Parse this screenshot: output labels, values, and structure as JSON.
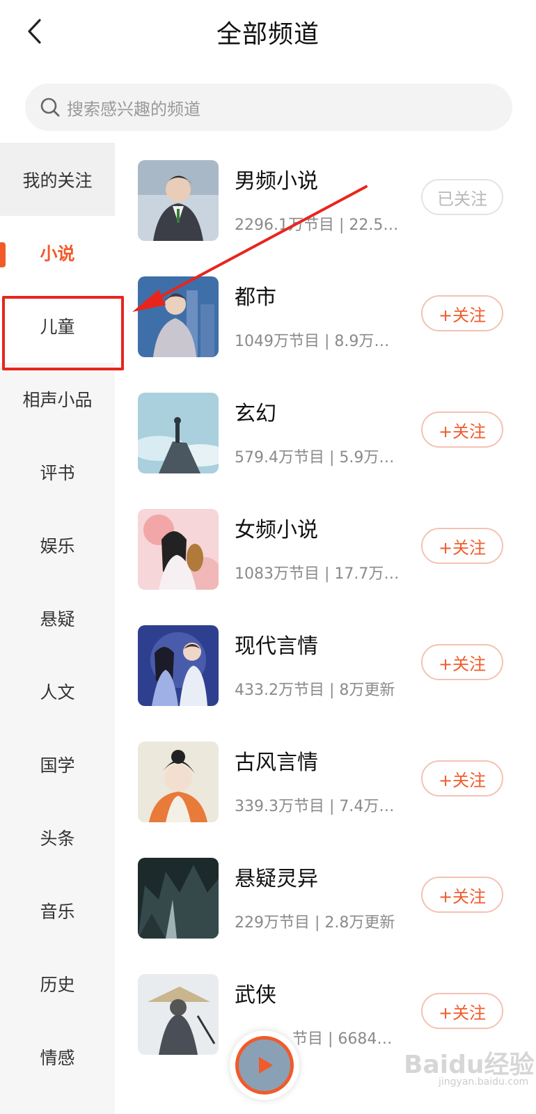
{
  "header": {
    "title": "全部频道",
    "back_icon": "chevron-left-icon"
  },
  "search": {
    "placeholder": "搜索感兴趣的频道",
    "icon": "search-icon"
  },
  "sidebar": {
    "items": [
      {
        "label": "我的关注"
      },
      {
        "label": "小说"
      },
      {
        "label": "儿童"
      },
      {
        "label": "相声小品"
      },
      {
        "label": "评书"
      },
      {
        "label": "娱乐"
      },
      {
        "label": "悬疑"
      },
      {
        "label": "人文"
      },
      {
        "label": "国学"
      },
      {
        "label": "头条"
      },
      {
        "label": "音乐"
      },
      {
        "label": "历史"
      },
      {
        "label": "情感"
      }
    ],
    "active_index": 1
  },
  "channels": [
    {
      "name": "男频小说",
      "meta": "2296.1万节目 | 22.5…",
      "button": "已关注",
      "followed": true
    },
    {
      "name": "都市",
      "meta": "1049万节目 | 8.9万…",
      "button": "+关注",
      "followed": false
    },
    {
      "name": "玄幻",
      "meta": "579.4万节目 | 5.9万…",
      "button": "+关注",
      "followed": false
    },
    {
      "name": "女频小说",
      "meta": "1083万节目 | 17.7万…",
      "button": "+关注",
      "followed": false
    },
    {
      "name": "现代言情",
      "meta": "433.2万节目 | 8万更新",
      "button": "+关注",
      "followed": false
    },
    {
      "name": "古风言情",
      "meta": "339.3万节目 | 7.4万…",
      "button": "+关注",
      "followed": false
    },
    {
      "name": "悬疑灵异",
      "meta": "229万节目 | 2.8万更新",
      "button": "+关注",
      "followed": false
    },
    {
      "name": "武侠",
      "meta": "节目 | 6684…",
      "button": "+关注",
      "followed": false
    }
  ],
  "colors": {
    "accent": "#f15a2a",
    "annotation": "#e8251d",
    "sidebar_bg": "#f6f6f7"
  },
  "watermark": {
    "text": "Baidu经验",
    "sub": "jingyan.baidu.com"
  }
}
